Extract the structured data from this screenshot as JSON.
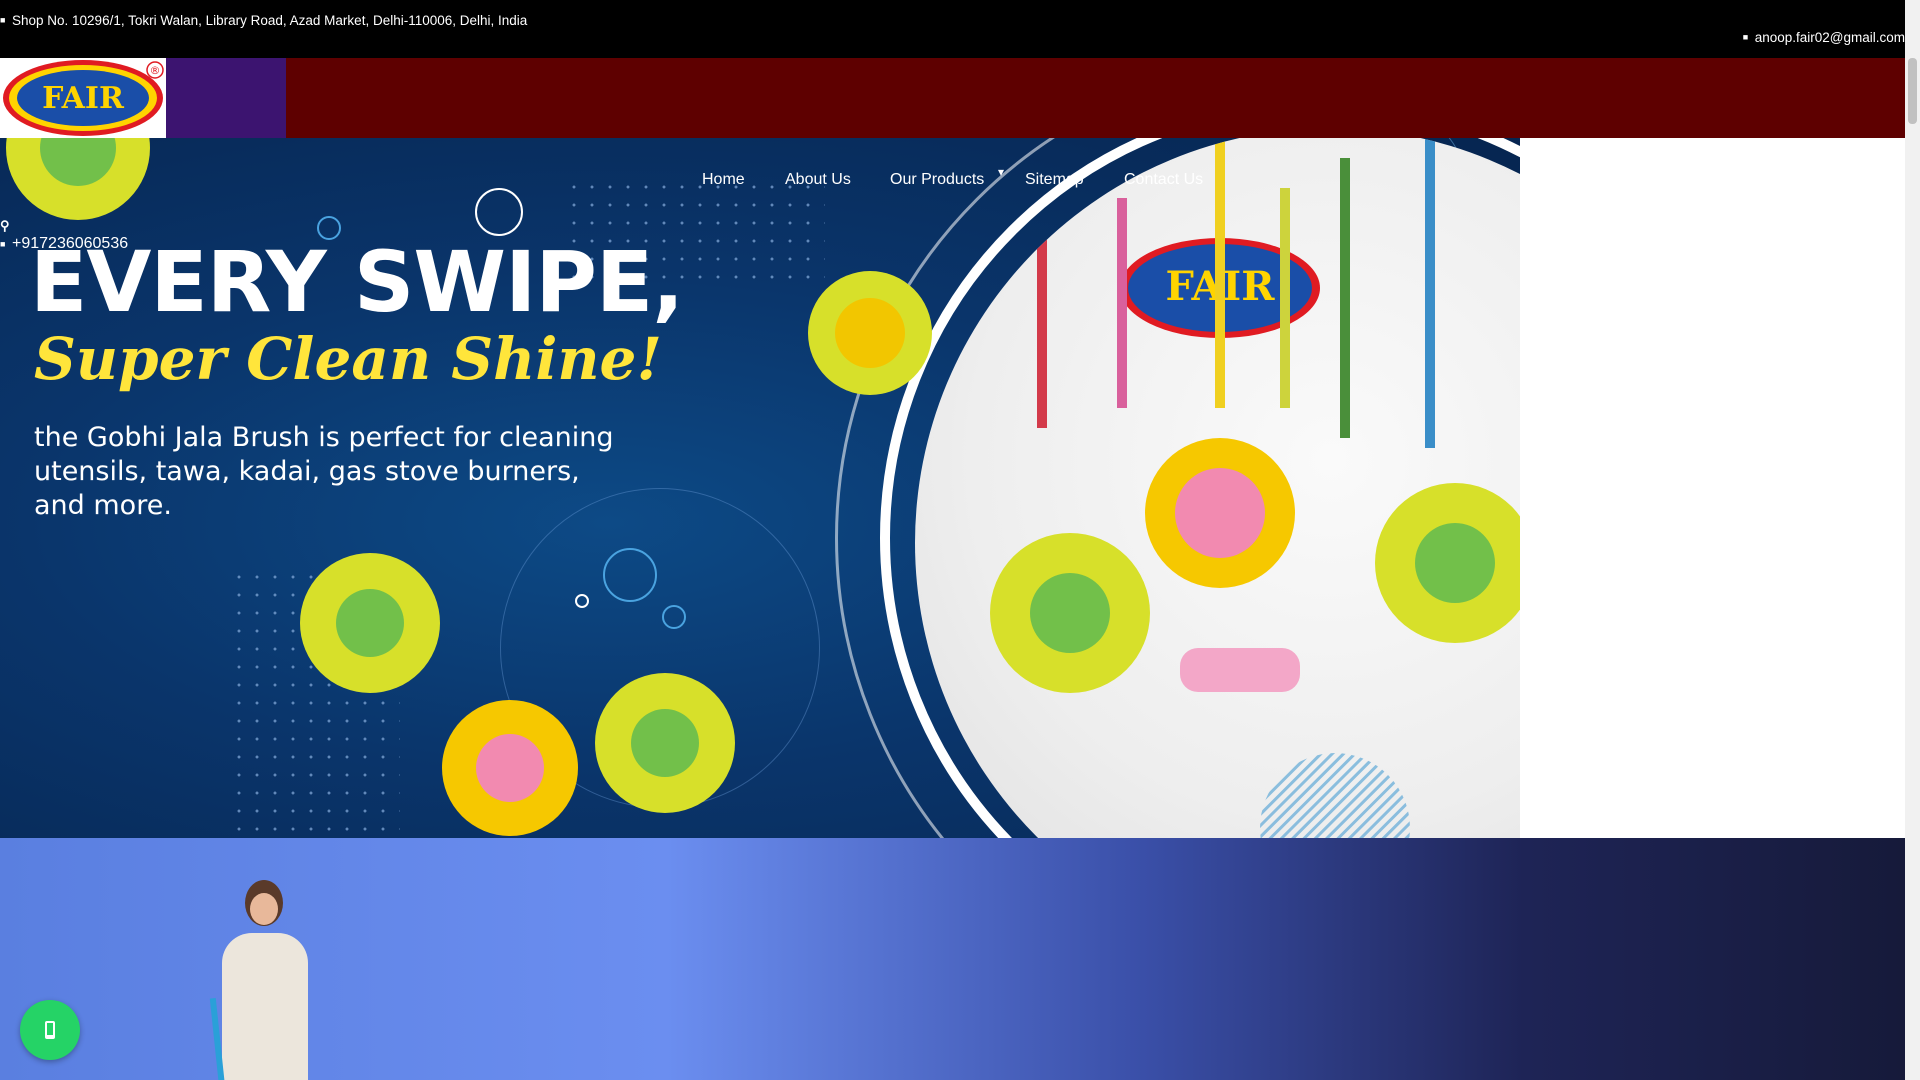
{
  "topbar": {
    "address": "Shop No. 10296/1, Tokri Walan, Library Road, Azad Market, Delhi-110006, Delhi, India",
    "email": "anoop.fair02@gmail.com"
  },
  "logo": {
    "text": "FAIR",
    "mark": "®"
  },
  "nav": {
    "home": "Home",
    "about": "About Us",
    "products": "Our Products",
    "sitemap": "Sitemap",
    "contact": "Contact Us"
  },
  "phone": "+917236060536",
  "hero": {
    "headline": "EVERY SWIPE,",
    "tagline": "Super Clean Shine!",
    "description": "the Gobhi Jala Brush is perfect for cleaning utensils, tawa, kadai, gas stove burners, and more.",
    "product_logo": "FAIR",
    "slides": 3
  },
  "colors": {
    "topbar": "#000000",
    "header": "#5e0000",
    "hero_bg": "#0a356b",
    "headline": "#ffffff",
    "tagline": "#ffe53b",
    "whatsapp": "#25d366"
  }
}
